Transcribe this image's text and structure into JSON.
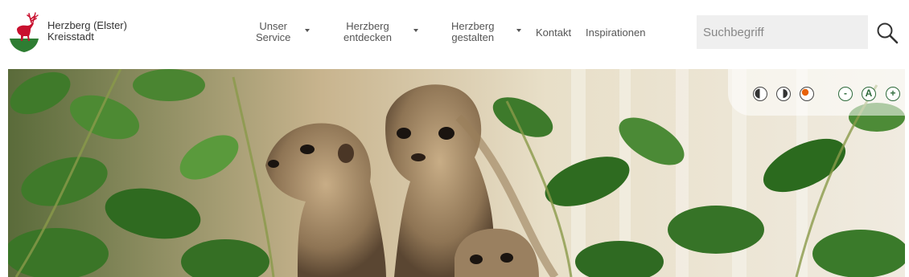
{
  "brand": {
    "line1": "Herzberg (Elster)",
    "line2": "Kreisstadt"
  },
  "nav": {
    "items": [
      {
        "line1": "Unser",
        "line2": "Service"
      },
      {
        "line1": "Herzberg",
        "line2": "entdecken"
      },
      {
        "line1": "Herzberg",
        "line2": "gestalten"
      }
    ],
    "links": [
      "Kontakt",
      "Inspirationen"
    ]
  },
  "search": {
    "placeholder": "Suchbegriff"
  },
  "accessibility": {
    "font_decrease": "-",
    "font_default": "A",
    "font_increase": "+"
  },
  "colors": {
    "crest_red": "#c8102e",
    "crest_green": "#2e7d32",
    "accent_orange": "#e8620c"
  }
}
